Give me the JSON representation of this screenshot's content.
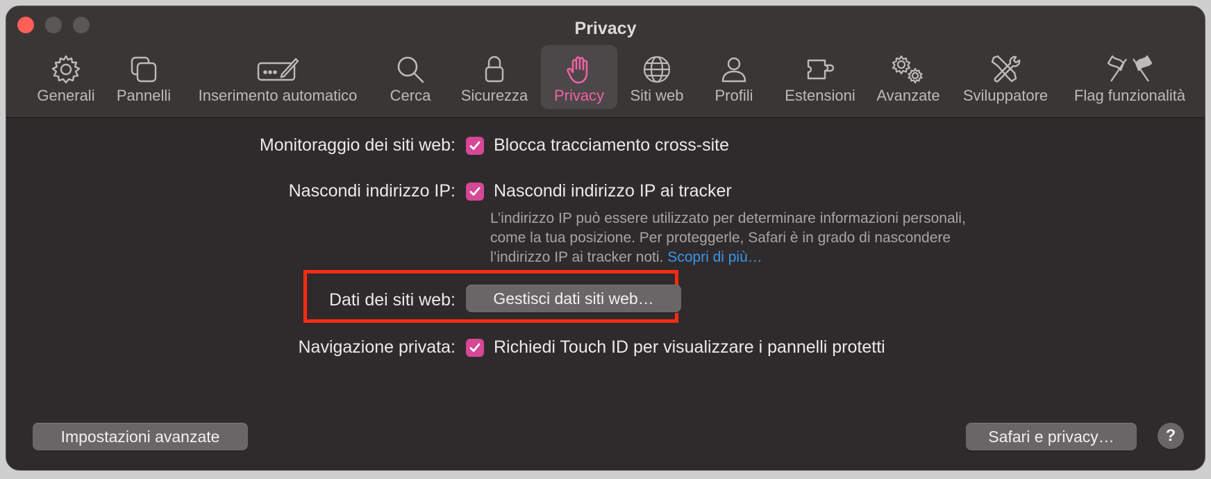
{
  "window": {
    "title": "Privacy"
  },
  "toolbar": {
    "tabs": [
      {
        "label": "Generali",
        "icon": "gear-icon"
      },
      {
        "label": "Pannelli",
        "icon": "tabs-icon"
      },
      {
        "label": "Inserimento automatico",
        "icon": "autofill-icon"
      },
      {
        "label": "Cerca",
        "icon": "search-icon"
      },
      {
        "label": "Sicurezza",
        "icon": "lock-icon"
      },
      {
        "label": "Privacy",
        "icon": "hand-icon",
        "active": true
      },
      {
        "label": "Siti web",
        "icon": "globe-icon"
      },
      {
        "label": "Profili",
        "icon": "person-icon"
      },
      {
        "label": "Estensioni",
        "icon": "puzzle-icon"
      },
      {
        "label": "Avanzate",
        "icon": "gears-icon"
      },
      {
        "label": "Sviluppatore",
        "icon": "tools-icon"
      },
      {
        "label": "Flag funzionalità",
        "icon": "flags-icon"
      }
    ]
  },
  "privacy": {
    "tracking": {
      "label": "Monitoraggio dei siti web:",
      "option": "Blocca tracciamento cross-site",
      "checked": true
    },
    "hide_ip": {
      "label": "Nascondi indirizzo IP:",
      "option": "Nascondi indirizzo IP ai tracker",
      "checked": true,
      "description": "L’indirizzo IP può essere utilizzato per determinare informazioni personali, come la tua posizione. Per proteggerle, Safari è in grado di nascondere l’indirizzo IP ai tracker noti.",
      "link": "Scopri di più…"
    },
    "website_data": {
      "label": "Dati dei siti web:",
      "button": "Gestisci dati siti web…"
    },
    "private_browsing": {
      "label": "Navigazione privata:",
      "option": "Richiedi Touch ID per visualizzare i pannelli protetti",
      "checked": true
    }
  },
  "footer": {
    "advanced_button": "Impostazioni avanzate",
    "safari_privacy_button": "Safari e privacy…",
    "help": "?"
  },
  "colors": {
    "accent": "#d64796",
    "active_tab_text": "#f062a6",
    "link": "#3b95f0",
    "highlight": "#ff2a13"
  }
}
